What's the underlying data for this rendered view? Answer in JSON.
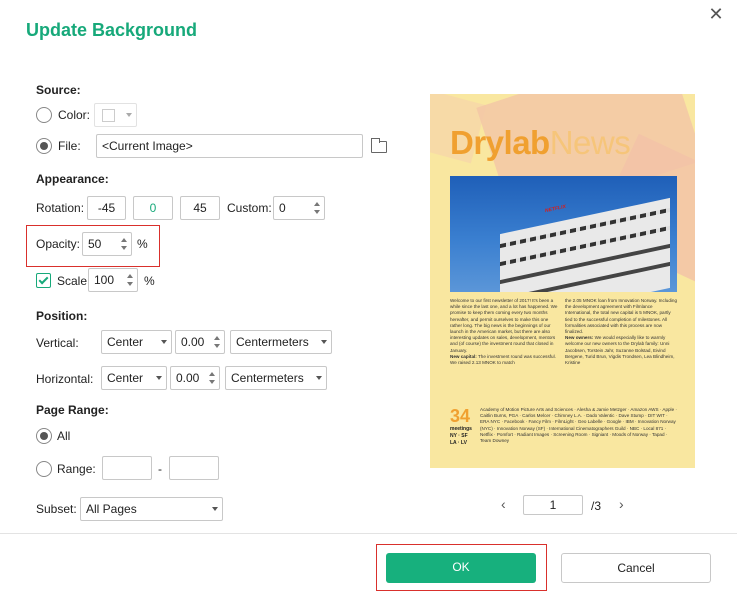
{
  "dialog": {
    "title": "Update Background",
    "close_glyph": "✕"
  },
  "source": {
    "heading": "Source:",
    "color_label": "Color:",
    "file_label": "File:",
    "file_value": "<Current Image>",
    "selected": "file"
  },
  "appearance": {
    "heading": "Appearance:",
    "rotation_label": "Rotation:",
    "rotation_options": [
      "-45",
      "0",
      "45"
    ],
    "custom_label": "Custom:",
    "custom_value": "0",
    "opacity_label": "Opacity:",
    "opacity_value": "50",
    "opacity_unit": "%",
    "scale_label": "Scale:",
    "scale_value": "100",
    "scale_unit": "%",
    "scale_checked": true
  },
  "position": {
    "heading": "Position:",
    "vertical_label": "Vertical:",
    "vertical_align": "Center",
    "vertical_offset": "0.00",
    "vertical_unit": "Centermeters",
    "horizontal_label": "Horizontal:",
    "horizontal_align": "Center",
    "horizontal_offset": "0.00",
    "horizontal_unit": "Centermeters"
  },
  "page_range": {
    "heading": "Page Range:",
    "all_label": "All",
    "range_label": "Range:",
    "range_separator": "-",
    "range_from": "",
    "range_to": "",
    "selected": "all",
    "subset_label": "Subset:",
    "subset_value": "All Pages"
  },
  "preview": {
    "logo_bold": "Drylab",
    "logo_light": "News",
    "photo_sign": "NETFLIX",
    "col1_text": "Welcome to our first newsletter of 2017! It's been a while since the last one, and a lot has happened. We promise to keep them coming every two months hereafter, and permit ourselves to make this one rather long. The big news is the beginnings of our launch in the American market, but there are also interesting updates on sales, development, mentors and (of course) the investment round that closed in January.",
    "col1_capital_heading": "New capital:",
    "col1_capital_text": " The investment round was successful. We raised 2.13 MNOK to match",
    "col2_text": "the 2.05 MNOK loan from Innovation Norway. Including the development agreement with Filmlance International, the total new capital is 5 MNOK, partly tied to the successful completion of milestones. All formalities associated with this process are now finalized.",
    "col2_owners_heading": "New owners:",
    "col2_owners_text": " We would especially like to warmly welcome our new owners to the Drylab family: Unni Jacobsen, Torstein Jahr, Suzanne Bolstad, Eivind Bergene, Turid Brun, Vigdis Trondsen, Lea Blindheim, Kristine",
    "big_number": "34",
    "meetings_lines": [
      "meetings",
      "NY · SF",
      "LA · LV"
    ],
    "meetings_text": "Academy of Motion Picture Arts and Sciences · Alesha & Jamie Metzger · Amazon AWS · Apple · Caitlin Burns, PGA · Carlos Melcer · Chimney L.A. · Dado Valentic · Dave Stump · DIT WIT · ERA NYC · Facebook · Fancy Film · FilmLight · Geo Labelle · Google · IBM · Innovation Norway (NYC) · Innovation Norway (SF) · International Cinematographers Guild · NBC · Local 871 · Netflix · Pomfort · Radiant Images · Screening Room · Signiant · Moods of Norway · Tapad · Team Downey"
  },
  "pager": {
    "prev_glyph": "‹",
    "next_glyph": "›",
    "current_page": "1",
    "total": "/3"
  },
  "buttons": {
    "ok_label": "OK",
    "cancel_label": "Cancel"
  },
  "colors": {
    "accent": "#17b07d",
    "highlight": "#d9302c"
  }
}
